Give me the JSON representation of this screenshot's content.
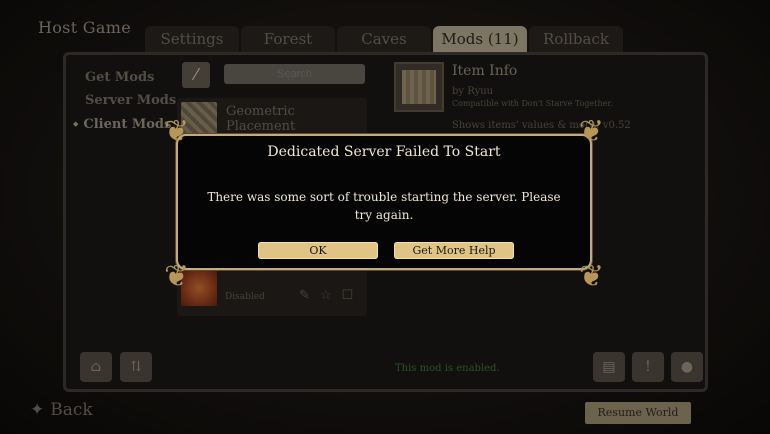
{
  "window": {
    "title": "Host Game"
  },
  "tabs": [
    {
      "label": "Settings"
    },
    {
      "label": "Forest"
    },
    {
      "label": "Caves"
    },
    {
      "label": "Mods (11)"
    },
    {
      "label": "Rollback"
    }
  ],
  "sidebar": {
    "items": [
      {
        "label": "Get Mods"
      },
      {
        "label": "Server Mods"
      },
      {
        "label": "Client Mods"
      }
    ]
  },
  "search": {
    "placeholder": "Search"
  },
  "mods": [
    {
      "name": "Geometric Placement"
    },
    {
      "name": "",
      "status": "Disabled"
    }
  ],
  "item_info": {
    "title": "Item Info",
    "author": "by Ryuu",
    "compat": "Compatible with Don't Starve Together.",
    "desc": "Shows items' values & more! v0.52"
  },
  "status_message": "This mod is enabled.",
  "nav": {
    "back_label": "Back",
    "resume_label": "Resume World"
  },
  "dialog": {
    "title": "Dedicated Server Failed To Start",
    "message": "There was some sort of trouble starting the server. Please try again.",
    "ok_label": "OK",
    "help_label": "Get More Help"
  },
  "colors": {
    "accent": "#dfc486",
    "dialog_border": "#c3ab7c",
    "enabled_text": "#3e6b33"
  }
}
